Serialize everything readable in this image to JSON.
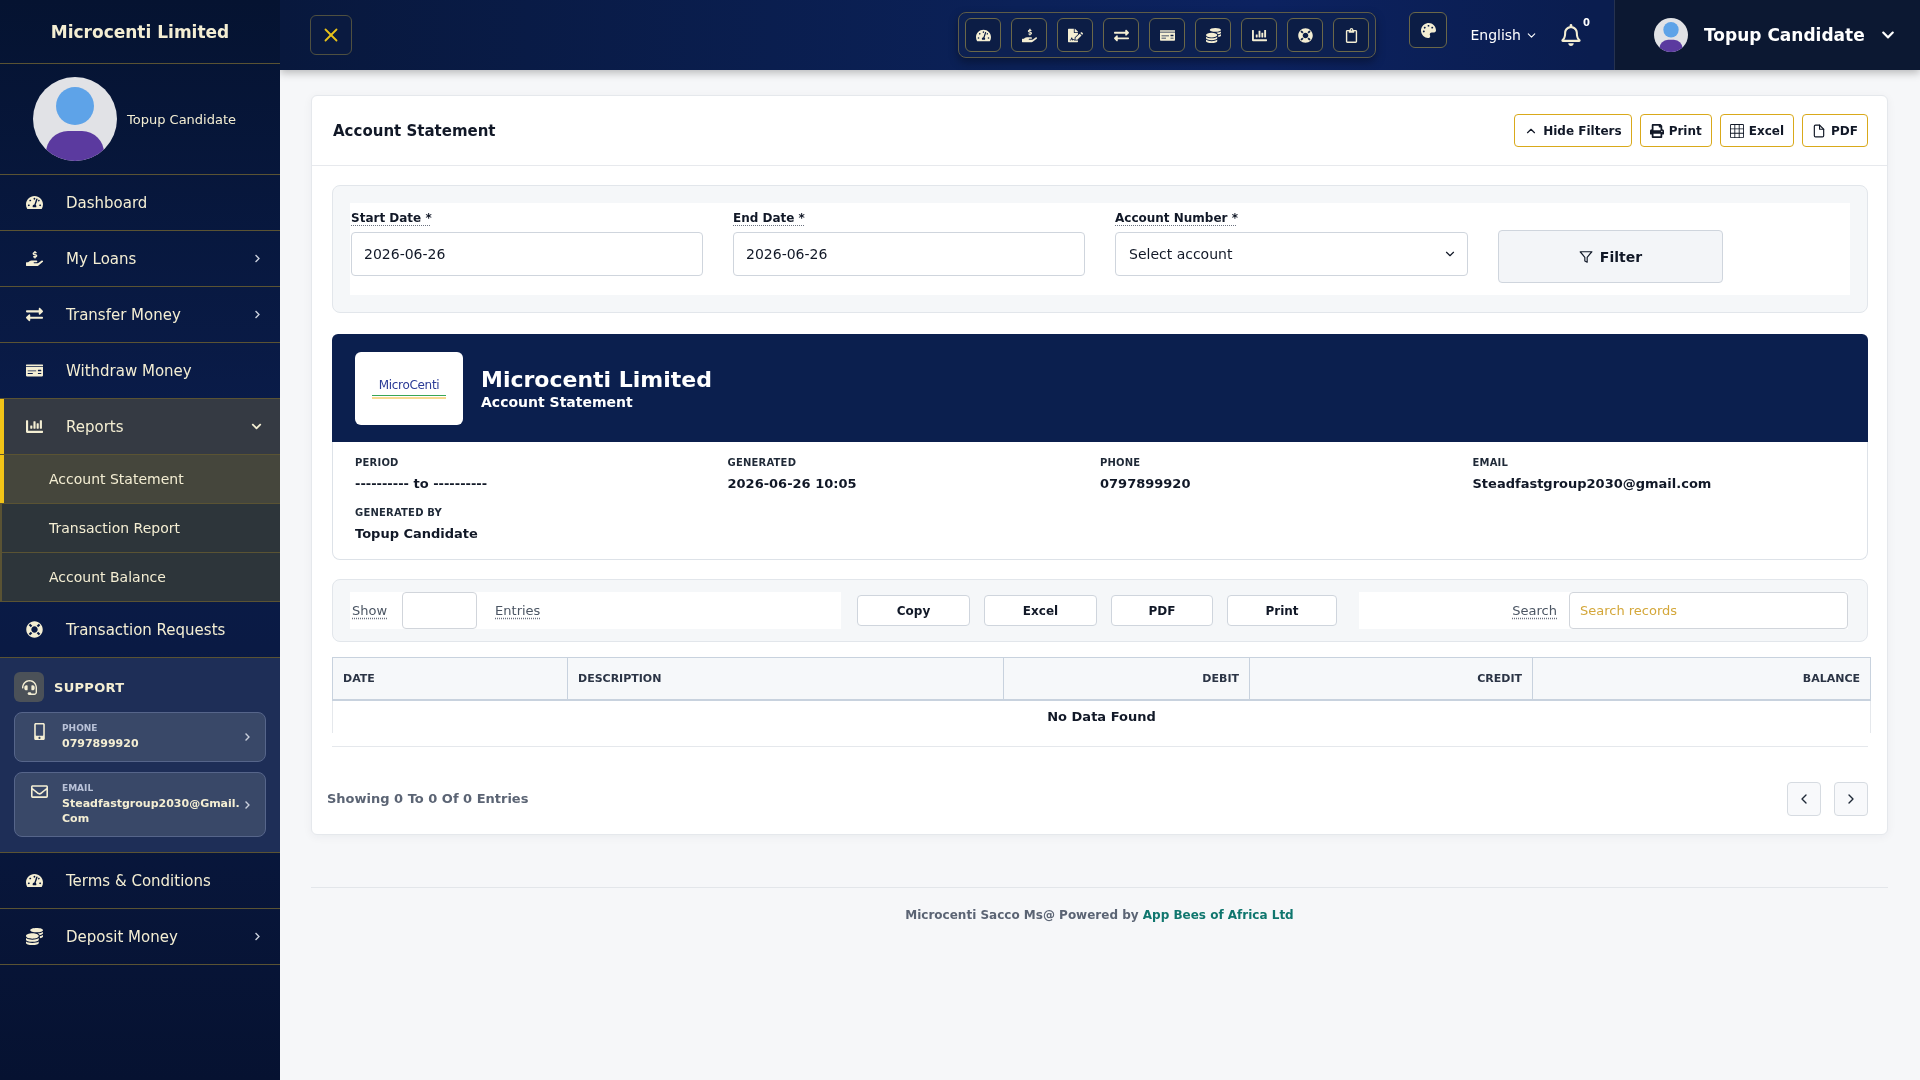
{
  "sidebar": {
    "brand": "Microcenti Limited",
    "profile": {
      "name": "Topup Candidate"
    },
    "items": [
      {
        "kind": "link",
        "label": "Dashboard",
        "selected": false
      },
      {
        "kind": "group",
        "label": "My Loans",
        "selected": false,
        "expanded": false
      },
      {
        "kind": "group",
        "label": "Transfer Money",
        "selected": false,
        "expanded": false
      },
      {
        "kind": "link",
        "label": "Withdraw Money",
        "selected": false
      },
      {
        "kind": "group",
        "label": "Reports",
        "selected": true,
        "expanded": true,
        "children": [
          {
            "label": "Account Statement",
            "selected": true
          },
          {
            "label": "Transaction Report",
            "selected": false
          },
          {
            "label": "Account Balance",
            "selected": false
          }
        ]
      },
      {
        "kind": "link",
        "label": "Transaction Requests",
        "selected": false
      },
      {
        "kind": "support",
        "label": "SUPPORT",
        "contacts": [
          {
            "label": "PHONE",
            "value": "0797899920"
          },
          {
            "label": "EMAIL",
            "value": "Steadfastgroup2030@Gmail.Com"
          }
        ]
      },
      {
        "kind": "link",
        "label": "Terms & Conditions",
        "selected": false
      },
      {
        "kind": "group",
        "label": "Deposit Money",
        "selected": false,
        "expanded": false
      }
    ]
  },
  "topbar": {
    "language": "English",
    "notification_count": "0",
    "user": {
      "name": "Topup Candidate"
    }
  },
  "page": {
    "title": "Account Statement",
    "actions": [
      "Hide Filters",
      "Print",
      "Excel",
      "PDF"
    ]
  },
  "filters": {
    "fields": [
      {
        "kind": "date",
        "label": "Start Date *",
        "value": "2026-06-26"
      },
      {
        "kind": "date",
        "label": "End Date *",
        "value": "2026-06-26"
      },
      {
        "kind": "select",
        "label": "Account Number *",
        "value": "Select account"
      }
    ],
    "button": "Filter"
  },
  "statement": {
    "logo_text": "MicroCenti",
    "company": "Microcenti Limited",
    "subtitle": "Account Statement",
    "details": [
      {
        "label": "PERIOD",
        "value": "---------- to ----------"
      },
      {
        "label": "GENERATED",
        "value": "2026-06-26 10:05"
      },
      {
        "label": "PHONE",
        "value": "0797899920"
      },
      {
        "label": "EMAIL",
        "value": "Steadfastgroup2030@gmail.com"
      },
      {
        "label": "GENERATED BY",
        "value": "Topup Candidate"
      }
    ]
  },
  "table_tools": {
    "show_label": "Show",
    "entries_label": "Entries",
    "buttons": [
      "Copy",
      "Excel",
      "PDF",
      "Print"
    ],
    "search_label": "Search",
    "search_placeholder": "Search records"
  },
  "table": {
    "columns": [
      {
        "label": "DATE",
        "kind": "text"
      },
      {
        "label": "DESCRIPTION",
        "kind": "text"
      },
      {
        "label": "DEBIT",
        "kind": "amount"
      },
      {
        "label": "CREDIT",
        "kind": "amount"
      },
      {
        "label": "BALANCE",
        "kind": "amount"
      }
    ],
    "empty_message": "No Data Found",
    "summary": "Showing 0 To 0 Of 0 Entries"
  },
  "footer": {
    "text": "Microcenti Sacco Ms@ Powered by",
    "link": "App Bees of Africa Ltd"
  }
}
